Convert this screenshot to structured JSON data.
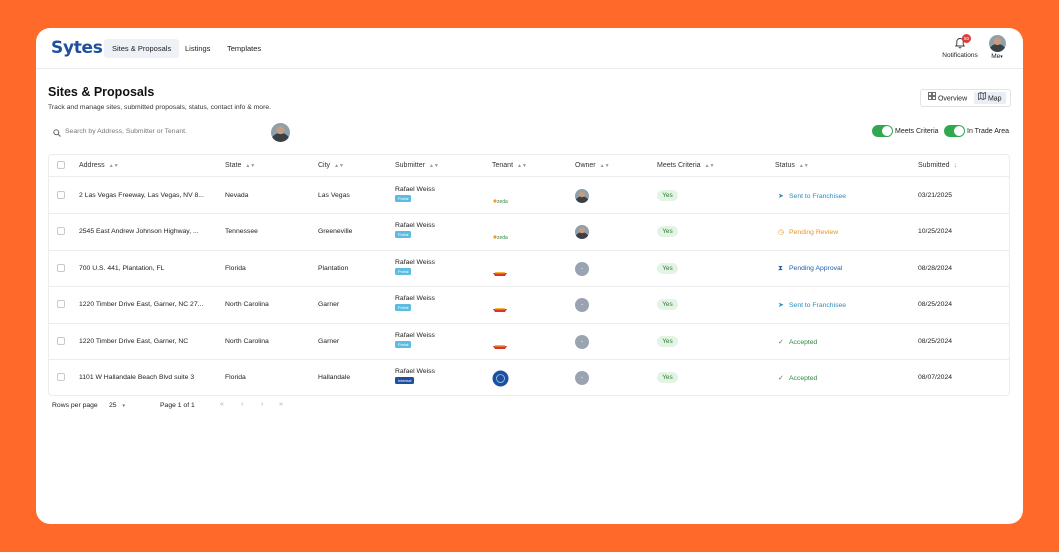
{
  "nav": {
    "logo": "Sytes",
    "items": [
      "Sites & Proposals",
      "Listings",
      "Templates"
    ],
    "notifications_label": "Notifications",
    "notifications_count": "50",
    "me_label": "Me"
  },
  "page": {
    "title": "Sites & Proposals",
    "subtitle": "Track and manage sites, submitted proposals, status, contact info & more.",
    "view_overview": "Overview",
    "view_map": "Map"
  },
  "search": {
    "placeholder": "Search by Address, Submitter or Tenant."
  },
  "filters": {
    "meets_criteria": "Meets Criteria",
    "in_trade_area": "In Trade Area"
  },
  "table": {
    "columns": [
      "Address",
      "State",
      "City",
      "Submitter",
      "Tenant",
      "Owner",
      "Meets Criteria",
      "Status",
      "Submitted"
    ],
    "rows": [
      {
        "address": "2 Las Vegas Freeway, Las Vegas, NV 8...",
        "state": "Nevada",
        "city": "Las Vegas",
        "submitter": "Rafael Weiss",
        "tag": "Portal",
        "tenant": "green-logo",
        "owner": "photo",
        "meets": "Yes",
        "status": "Sent to Franchisee",
        "status_icon": "send-icon",
        "status_color": "#2E8BC0",
        "submitted": "03/21/2025"
      },
      {
        "address": "2545 East Andrew Johnson Highway, ...",
        "state": "Tennessee",
        "city": "Greeneville",
        "submitter": "Rafael Weiss",
        "tag": "Portal",
        "tenant": "green-logo",
        "owner": "photo",
        "meets": "Yes",
        "status": "Pending Review",
        "status_icon": "clock-icon",
        "status_color": "#E8951E",
        "submitted": "10/25/2024"
      },
      {
        "address": "700 U.S. 441, Plantation, FL",
        "state": "Florida",
        "city": "Plantation",
        "submitter": "Rafael Weiss",
        "tag": "Portal",
        "tenant": "red-logo",
        "owner": "empty",
        "meets": "Yes",
        "status": "Pending Approval",
        "status_icon": "hourglass-icon",
        "status_color": "#1F5FA8",
        "submitted": "08/28/2024"
      },
      {
        "address": "1220 Timber Drive East, Garner, NC 27...",
        "state": "North Carolina",
        "city": "Garner",
        "submitter": "Rafael Weiss",
        "tag": "Portal",
        "tenant": "red-logo",
        "owner": "empty",
        "meets": "Yes",
        "status": "Sent to Franchisee",
        "status_icon": "send-icon",
        "status_color": "#2E8BC0",
        "submitted": "08/25/2024"
      },
      {
        "address": "1220 Timber Drive East, Garner, NC",
        "state": "North Carolina",
        "city": "Garner",
        "submitter": "Rafael Weiss",
        "tag": "Portal",
        "tenant": "red-logo",
        "owner": "empty",
        "meets": "Yes",
        "status": "Accepted",
        "status_icon": "check-circle-icon",
        "status_color": "#2F8A3E",
        "submitted": "08/25/2024"
      },
      {
        "address": "1101 W Hallandale Beach Blvd suite 3",
        "state": "Florida",
        "city": "Hallandale",
        "submitter": "Rafael Weiss",
        "tag": "Internal",
        "tenant": "blue-circle-logo",
        "owner": "empty",
        "meets": "Yes",
        "status": "Accepted",
        "status_icon": "check-circle-icon",
        "status_color": "#2F8A3E",
        "submitted": "08/07/2024"
      }
    ]
  },
  "pagination": {
    "rows_per_page_label": "Rows per page",
    "rows_per_page": "25",
    "page_info": "Page 1 of 1"
  },
  "colors": {
    "background": "#FF6A2A",
    "brand": "#1F4FA0",
    "toggle_on": "#2FA84F"
  }
}
